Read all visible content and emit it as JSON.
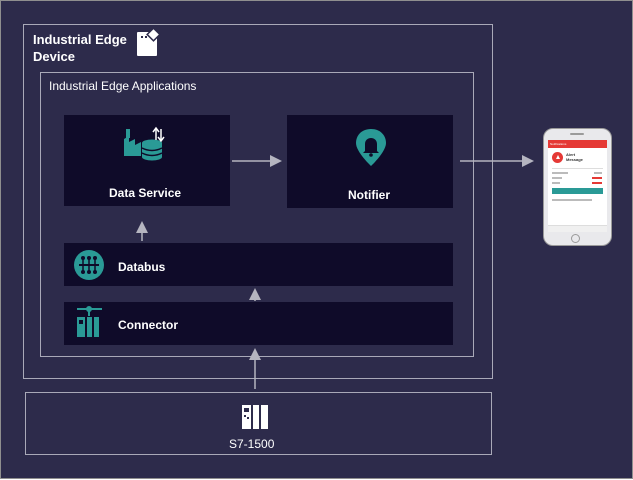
{
  "device": {
    "title_line1": "Industrial Edge",
    "title_line2": "Device"
  },
  "apps": {
    "title": "Industrial Edge Applications"
  },
  "nodes": {
    "data_service": "Data Service",
    "notifier": "Notifier",
    "databus": "Databus",
    "connector": "Connector",
    "plc": "S7-1500"
  },
  "phone": {
    "app_header": "Notifications",
    "alert_title_line1": "Alert",
    "alert_title_line2": "Message"
  },
  "colors": {
    "background": "#2d2b4b",
    "panel": "#0f0b29",
    "accent_teal": "#2a9a96",
    "border": "#a9a9b8",
    "alert_red": "#e53935"
  },
  "icons": {
    "device": "edge-device-icon",
    "data_service": "data-service-icon",
    "notifier": "bell-pin-icon",
    "databus": "databus-icon",
    "connector": "connector-icon",
    "plc": "plc-icon",
    "phone": "smartphone-icon"
  }
}
